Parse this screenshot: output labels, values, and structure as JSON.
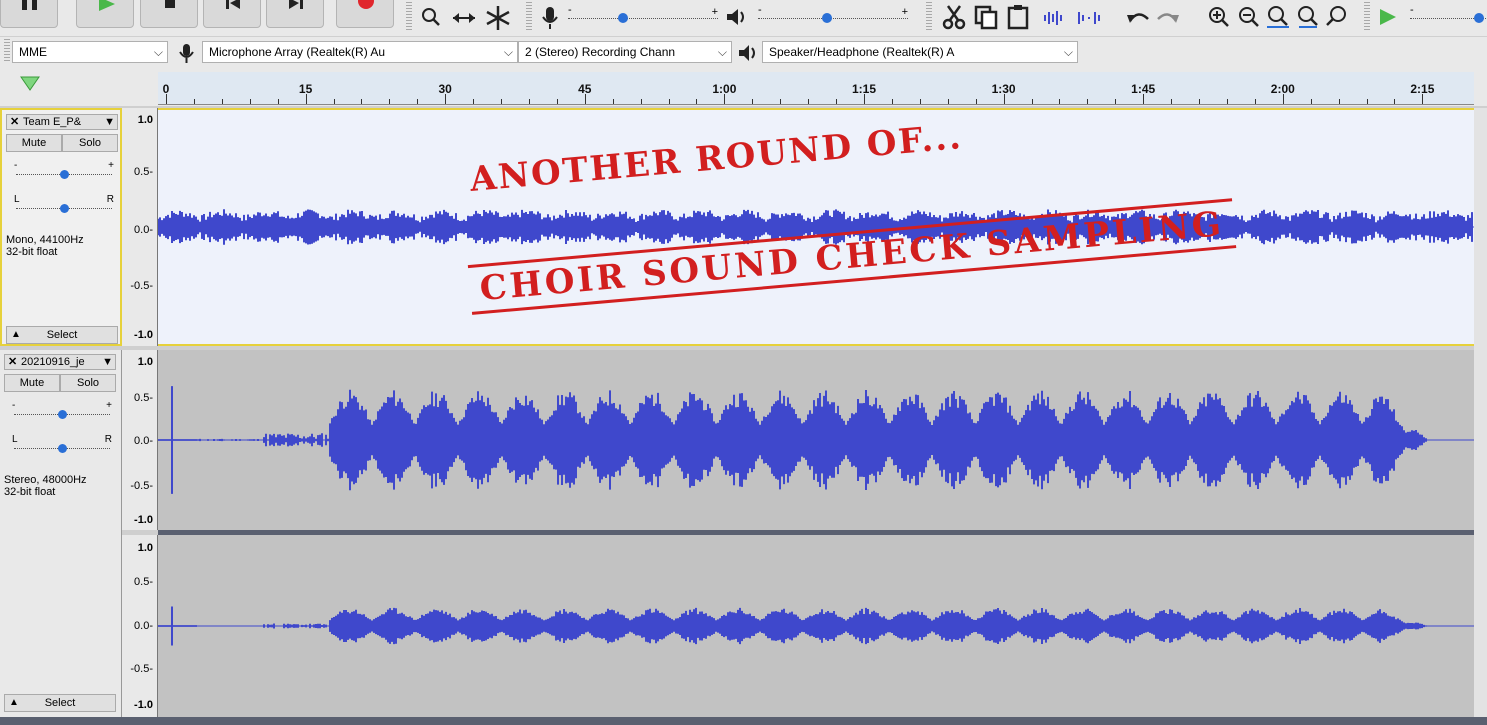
{
  "toolbar": {
    "transport": [
      "pause",
      "play",
      "stop",
      "skip-start",
      "skip-end",
      "record"
    ],
    "tools": [
      "zoom",
      "time-shift",
      "multi"
    ],
    "edit": [
      "cut",
      "copy",
      "paste",
      "trim",
      "silence",
      "undo",
      "redo",
      "zoom-in",
      "zoom-out",
      "fit-selection",
      "fit-project",
      "zoom-toggle",
      "play-at-speed"
    ]
  },
  "devices": {
    "host": "MME",
    "input_device": "Microphone Array (Realtek(R) Au",
    "channels": "2 (Stereo) Recording Chann",
    "output_device": "Speaker/Headphone (Realtek(R) A"
  },
  "ruler": {
    "labels": [
      "0",
      "15",
      "30",
      "45",
      "1:00",
      "1:15",
      "1:30",
      "1:45",
      "2:00",
      "2:15"
    ]
  },
  "tracks": [
    {
      "name": "Team E_P&",
      "mute": "Mute",
      "solo": "Solo",
      "gain_minus": "-",
      "gain_plus": "+",
      "pan_left": "L",
      "pan_right": "R",
      "info_line1": "Mono, 44100Hz",
      "info_line2": "32-bit float",
      "select": "Select",
      "scale": [
        "1.0",
        "0.5-",
        "0.0-",
        "-0.5-",
        "-1.0"
      ]
    },
    {
      "name": "20210916_je",
      "mute": "Mute",
      "solo": "Solo",
      "gain_minus": "-",
      "gain_plus": "+",
      "pan_left": "L",
      "pan_right": "R",
      "info_line1": "Stereo, 48000Hz",
      "info_line2": "32-bit float",
      "select": "Select",
      "scale_top": [
        "1.0",
        "0.5-",
        "0.0-",
        "-0.5-",
        "-1.0"
      ],
      "scale_bottom": [
        "1.0",
        "0.5-",
        "0.0-",
        "-0.5-",
        "-1.0"
      ]
    }
  ],
  "overlay": {
    "line1": "ANOTHER ROUND OF...",
    "line2": "CHOIR SOUND CHECK SAMPLING"
  },
  "colors": {
    "waveform": "#3f48cc",
    "selected_bg": "#eef2fb",
    "unselected_bg": "#c2c2c2",
    "overlay_red": "#d21f1f",
    "selection_border": "#e6d13b"
  }
}
